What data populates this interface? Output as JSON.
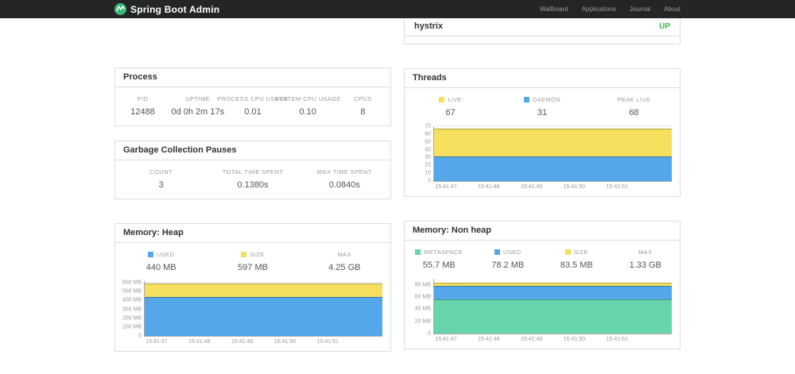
{
  "navbar": {
    "brand": "Spring Boot Admin",
    "links": [
      {
        "label": "Wallboard"
      },
      {
        "label": "Applications"
      },
      {
        "label": "Journal"
      },
      {
        "label": "About"
      }
    ]
  },
  "health_card": {
    "item": "hystrix",
    "status": "UP",
    "status_color": "#45b649"
  },
  "cards": {
    "process": {
      "title": "Process",
      "stats": [
        {
          "label": "PID",
          "value": "12488"
        },
        {
          "label": "UPTIME",
          "value": "0d 0h 2m 17s"
        },
        {
          "label": "PROCESS CPU USAGE",
          "value": "0.01"
        },
        {
          "label": "SYSTEM CPU USAGE",
          "value": "0.10"
        },
        {
          "label": "CPUS",
          "value": "8"
        }
      ]
    },
    "gc": {
      "title": "Garbage Collection Pauses",
      "stats": [
        {
          "label": "COUNT",
          "value": "3"
        },
        {
          "label": "TOTAL TIME SPENT",
          "value": "0.1380s"
        },
        {
          "label": "MAX TIME SPENT",
          "value": "0.0840s"
        }
      ]
    },
    "threads": {
      "title": "Threads",
      "stats": [
        {
          "label": "LIVE",
          "color": "#F7DF5E",
          "value": "67"
        },
        {
          "label": "DAEMON",
          "color": "#54A7E9",
          "value": "31"
        },
        {
          "label": "PEAK LIVE",
          "value": "68"
        }
      ]
    },
    "heap": {
      "title": "Memory: Heap",
      "stats": [
        {
          "label": "USED",
          "color": "#54A7E9",
          "value": "440 MB"
        },
        {
          "label": "SIZE",
          "color": "#F7DF5E",
          "value": "597 MB"
        },
        {
          "label": "MAX",
          "value": "4.25 GB"
        }
      ]
    },
    "nonheap": {
      "title": "Memory: Non heap",
      "stats": [
        {
          "label": "METASPACE",
          "color": "#68D4AB",
          "value": "55.7 MB"
        },
        {
          "label": "USED",
          "color": "#54A7E9",
          "value": "78.2 MB"
        },
        {
          "label": "SIZE",
          "color": "#F7DF5E",
          "value": "83.5 MB"
        },
        {
          "label": "MAX",
          "value": "1.33 GB"
        }
      ]
    }
  },
  "chart_data": [
    {
      "id": "threads",
      "type": "area",
      "title": "Threads",
      "x": [
        "15:41:47",
        "15:41:48",
        "15:41:49",
        "15:41:50",
        "15:41:51"
      ],
      "series": [
        {
          "name": "LIVE",
          "color": "#F7DF5E",
          "values": [
            67,
            67,
            67,
            67,
            67
          ]
        },
        {
          "name": "DAEMON",
          "color": "#54A7E9",
          "values": [
            31,
            31,
            31,
            31,
            31
          ]
        }
      ],
      "ylim": [
        0,
        70
      ],
      "yticks": [
        0,
        10,
        20,
        30,
        40,
        50,
        60,
        70
      ],
      "ytick_labels": [
        "0",
        "10",
        "20",
        "30",
        "40",
        "50",
        "60",
        "70"
      ],
      "grid": true,
      "legend_position": "top"
    },
    {
      "id": "memory-heap",
      "type": "area",
      "title": "Memory: Heap",
      "x": [
        "15:41:47",
        "15:41:48",
        "15:41:49",
        "15:41:50",
        "15:41:51"
      ],
      "series": [
        {
          "name": "SIZE",
          "color": "#F7DF5E",
          "values": [
            597,
            597,
            597,
            597,
            597
          ]
        },
        {
          "name": "USED",
          "color": "#54A7E9",
          "values": [
            440,
            440,
            440,
            440,
            440
          ]
        }
      ],
      "ylim": [
        0,
        620
      ],
      "yticks": [
        0,
        100,
        200,
        300,
        400,
        500,
        600
      ],
      "ytick_labels": [
        "0",
        "100 MB",
        "200 MB",
        "300 MB",
        "400 MB",
        "500 MB",
        "600 MB"
      ],
      "grid": true,
      "legend_position": "top"
    },
    {
      "id": "memory-nonheap",
      "type": "area",
      "title": "Memory: Non heap",
      "x": [
        "15:41:47",
        "15:41:48",
        "15:41:49",
        "15:41:50",
        "15:41:51"
      ],
      "series": [
        {
          "name": "SIZE",
          "color": "#F7DF5E",
          "values": [
            83.5,
            83.5,
            83.5,
            83.5,
            83.5
          ]
        },
        {
          "name": "USED",
          "color": "#54A7E9",
          "values": [
            78.2,
            78.2,
            78.2,
            78.2,
            78.2
          ]
        },
        {
          "name": "METASPACE",
          "color": "#68D4AB",
          "values": [
            55.7,
            55.7,
            55.7,
            55.7,
            55.7
          ]
        }
      ],
      "ylim": [
        0,
        90
      ],
      "yticks": [
        0,
        20,
        40,
        60,
        80
      ],
      "ytick_labels": [
        "0",
        "20 MB",
        "40 MB",
        "60 MB",
        "80 MB"
      ],
      "grid": true,
      "legend_position": "top"
    }
  ]
}
